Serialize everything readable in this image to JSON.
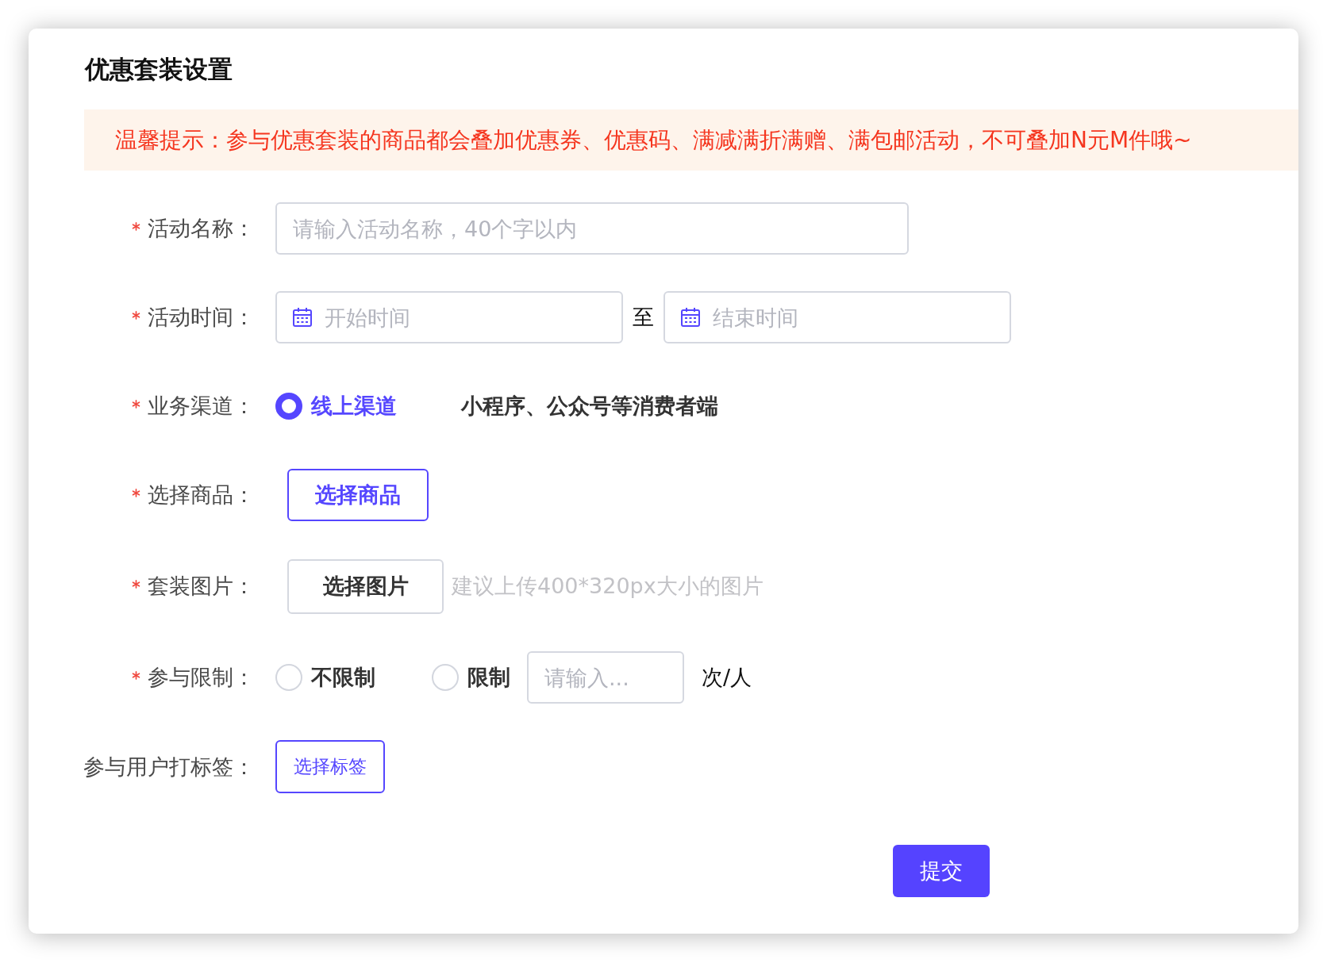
{
  "title": "优惠套装设置",
  "notice": "温馨提示：参与优惠套装的商品都会叠加优惠券、优惠码、满减满折满赠、满包邮活动，不可叠加N元M件哦~",
  "form": {
    "fields": [
      {
        "kind": "text",
        "label": "活动名称：",
        "required": true,
        "placeholder": "请输入活动名称，40个字以内"
      },
      {
        "kind": "daterange",
        "label": "活动时间：",
        "required": true,
        "start_placeholder": "开始时间",
        "separator": "至",
        "end_placeholder": "结束时间"
      },
      {
        "kind": "radio",
        "label": "业务渠道：",
        "required": true,
        "options": [
          {
            "label": "线上渠道",
            "selected": true
          }
        ],
        "note": "小程序、公众号等消费者端"
      },
      {
        "kind": "product",
        "label": "选择商品：",
        "required": true,
        "button": "选择商品"
      },
      {
        "kind": "image",
        "label": "套装图片：",
        "required": true,
        "button": "选择图片",
        "hint": "建议上传400*320px大小的图片"
      },
      {
        "kind": "radio",
        "label": "参与限制：",
        "required": true,
        "options": [
          {
            "label": "不限制",
            "selected": false
          },
          {
            "label": "限制",
            "selected": false
          }
        ],
        "placeholder": "请输入...",
        "unit": "次/人"
      },
      {
        "kind": "tag",
        "label": "参与用户打标签：",
        "required": false,
        "button": "选择标签"
      }
    ],
    "submit_button": "提交"
  }
}
